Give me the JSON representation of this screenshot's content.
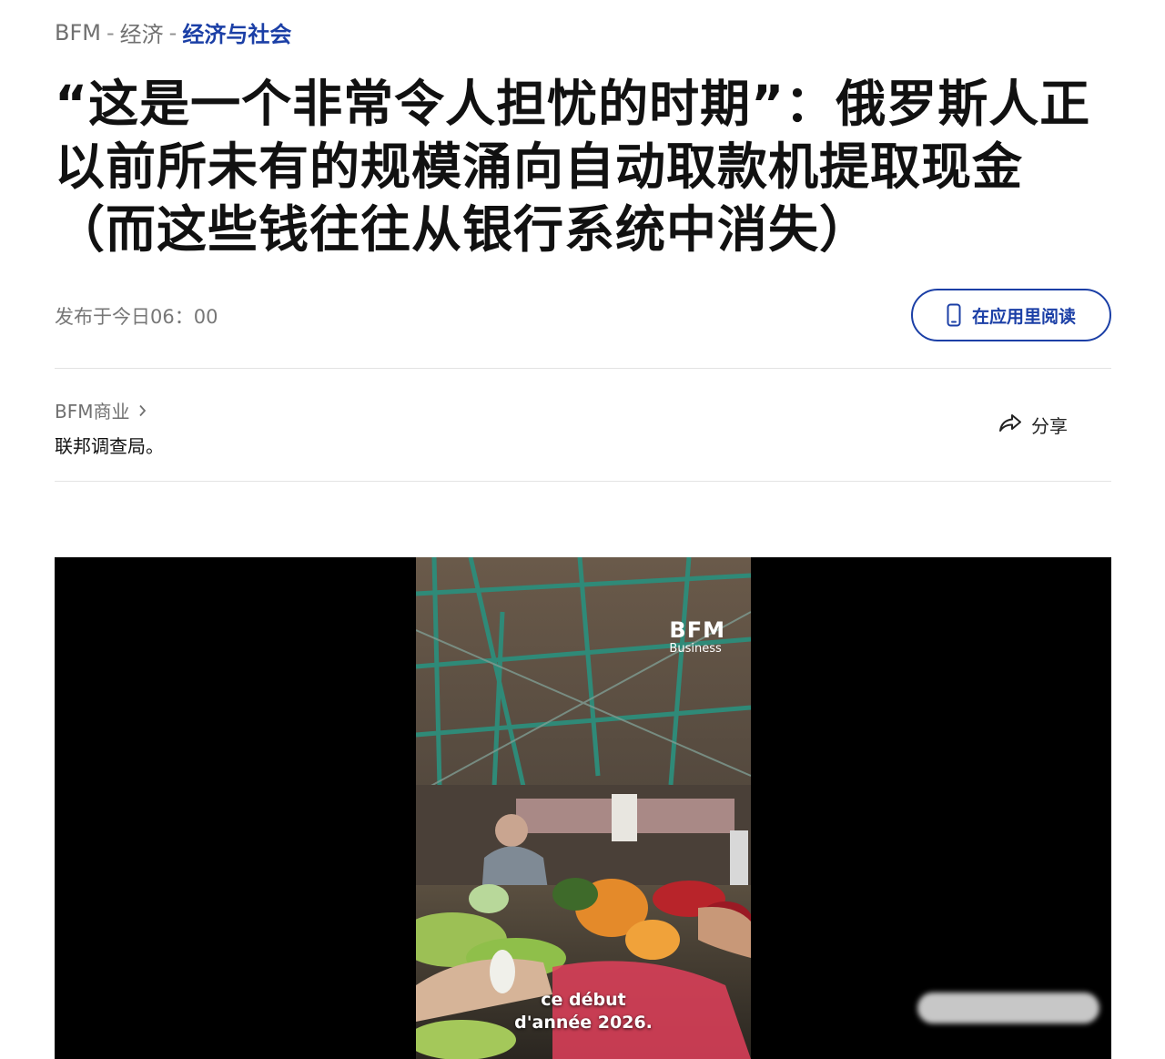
{
  "breadcrumb": {
    "items": [
      {
        "label": "BFM"
      },
      {
        "label": "经济"
      },
      {
        "label": "经济与社会"
      }
    ],
    "separator": "-"
  },
  "article": {
    "title_lines": [
      "“这是一个非常令人担忧的时期”：俄罗斯人正",
      "以前所未有的规模涌向自动取款机提取现金",
      "（而这些钱往往从银行系统中消失）"
    ],
    "published": "发布于今日06：00",
    "source_label": "BFM商业",
    "author": "联邦调查局。"
  },
  "actions": {
    "read_in_app": "在应用里阅读",
    "share": "分享"
  },
  "video": {
    "logo_main": "BFM",
    "logo_sub": "Business",
    "caption_lines": [
      "ce début",
      "d'année 2026."
    ]
  },
  "icons": {
    "read_in_app": "phone-icon",
    "source": "chevron-right-icon",
    "share": "share-arrow-icon"
  },
  "colors": {
    "accent": "#1b3fa6",
    "muted_text": "#707070",
    "title_text": "#111111",
    "video_bg": "#000000"
  }
}
